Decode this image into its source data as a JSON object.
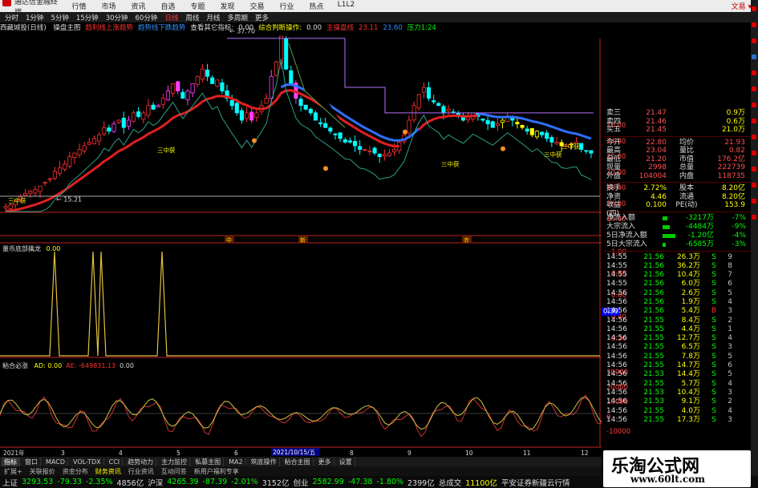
{
  "menubar": {
    "app_title": "通达信金融终端",
    "items": [
      "行情",
      "市场",
      "资讯",
      "自选",
      "专题",
      "发现",
      "交易",
      "行业",
      "热点",
      "L1L2"
    ],
    "right_text": "文易 ▾"
  },
  "periods": [
    "分时",
    "1分钟",
    "5分钟",
    "15分钟",
    "30分钟",
    "60分钟",
    "日线",
    "周线",
    "月线",
    "多周期",
    "更多"
  ],
  "period_active_index": 6,
  "chart_header": {
    "stock": "西藏城投(日线)",
    "items": [
      {
        "text": "操盘主图",
        "color": "#dddddd"
      },
      {
        "text": "趋利线上涨趋势",
        "color": "#ff3030"
      },
      {
        "text": "趋势线下跌趋势",
        "color": "#3090ff"
      },
      {
        "text": "查看其它指标:",
        "color": "#dddddd"
      },
      {
        "text": "0.00",
        "color": "#dddddd"
      },
      {
        "text": "综合判断操作:",
        "color": "#ffff00"
      },
      {
        "text": "0.00",
        "color": "#dddddd"
      },
      {
        "text": "主操盘线",
        "color": "#ff3030"
      },
      {
        "text": "23.11",
        "color": "#ff3030"
      },
      {
        "text": "23.60",
        "color": "#3090ff"
      },
      {
        "text": "压力1:24",
        "color": "#00ff00"
      }
    ]
  },
  "main_chart": {
    "high_label": "37.70",
    "low_label": "15.21",
    "signal_labels": [
      "三中获",
      "三中获",
      "三中获",
      "三中获",
      "三中获"
    ],
    "badges": [
      "中",
      "新",
      "赤"
    ],
    "price_axis": [
      "26.00",
      "24.00",
      "22.00",
      "20.00",
      "18.00",
      "16.00",
      "14.00"
    ]
  },
  "indicator1": {
    "label": "量币底部擒龙",
    "value": "0.00",
    "axis": [
      "1.00",
      "0.80",
      "0.60",
      "0.40",
      "0.20"
    ],
    "current": "0.39"
  },
  "indicator2": {
    "label": "粘合必涨",
    "items": [
      {
        "text": "AD: 0.00",
        "color": "#ffff00"
      },
      {
        "text": "AE: -649831.13",
        "color": "#ff3030"
      },
      {
        "text": "0.00",
        "color": "#dddddd"
      }
    ],
    "axis": [
      "30000",
      "20000",
      "10000",
      "0",
      "-10000"
    ]
  },
  "date_axis": {
    "labels": [
      "2021年",
      "3",
      "4",
      "5",
      "6",
      "7",
      "8",
      "9",
      "10",
      "11",
      "12"
    ],
    "highlight": "2021/10/15/五"
  },
  "quote": {
    "asks": [
      {
        "label": "卖三",
        "price": "21.47",
        "vol": "0.9万",
        "color": "#ff5050"
      },
      {
        "label": "卖四",
        "price": "21.46",
        "vol": "0.6万",
        "color": "#ff5050"
      },
      {
        "label": "买五",
        "price": "21.45",
        "vol": "21.0万",
        "color": "#ff5050"
      }
    ],
    "stats": [
      {
        "l1": "今开",
        "v1": "22.80",
        "l2": "均价",
        "v2": "21.93"
      },
      {
        "l1": "最高",
        "v1": "23.04",
        "l2": "量比",
        "v2": "0.82"
      },
      {
        "l1": "最低",
        "v1": "21.20",
        "l2": "市值",
        "v2": "176.2亿"
      },
      {
        "l1": "现量",
        "v1": "2998",
        "l2": "总量",
        "v2": "222739"
      },
      {
        "l1": "外盘",
        "v1": "104004",
        "l2": "内盘",
        "v2": "118735"
      }
    ],
    "fund": [
      {
        "l1": "换手",
        "v1": "2.72%",
        "l2": "股本",
        "v2": "8.20亿"
      },
      {
        "l1": "净资",
        "v1": "4.46",
        "l2": "流通",
        "v2": "8.20亿"
      },
      {
        "l1": "收益(四)",
        "v1": "0.100",
        "l2": "PE(动)",
        "v2": "153.9"
      }
    ],
    "flows": [
      {
        "name": "净流入额",
        "val": "-3217万",
        "pct": "-7%",
        "w": 6
      },
      {
        "name": "大宗流入",
        "val": "-4484万",
        "pct": "-9%",
        "w": 9
      },
      {
        "name": "5日净流入额",
        "val": "-1.20亿",
        "pct": "-4%",
        "w": 16
      },
      {
        "name": "5日大宗流入",
        "val": "-6585万",
        "pct": "-3%",
        "w": 4
      }
    ],
    "trades": [
      {
        "t": "14:55",
        "p": "21.56",
        "v": "26.3万",
        "s": "S",
        "n": "9"
      },
      {
        "t": "14:55",
        "p": "21.56",
        "v": "36.2万",
        "s": "S",
        "n": "8"
      },
      {
        "t": "14:55",
        "p": "21.56",
        "v": "10.4万",
        "s": "S",
        "n": "7"
      },
      {
        "t": "14:55",
        "p": "21.56",
        "v": "6.0万",
        "s": "S",
        "n": "6"
      },
      {
        "t": "14:56",
        "p": "21.56",
        "v": "2.6万",
        "s": "S",
        "n": "5"
      },
      {
        "t": "14:56",
        "p": "21.56",
        "v": "1.9万",
        "s": "S",
        "n": "4"
      },
      {
        "t": "14:56",
        "p": "21.56",
        "v": "5.4万",
        "s": "B",
        "n": "3"
      },
      {
        "t": "14:56",
        "p": "21.55",
        "v": "8.4万",
        "s": "S",
        "n": "2"
      },
      {
        "t": "14:56",
        "p": "21.55",
        "v": "4.4万",
        "s": "S",
        "n": "1"
      },
      {
        "t": "14:56",
        "p": "21.55",
        "v": "12.7万",
        "s": "S",
        "n": "4"
      },
      {
        "t": "14:56",
        "p": "21.55",
        "v": "6.5万",
        "s": "S",
        "n": "3"
      },
      {
        "t": "14:56",
        "p": "21.55",
        "v": "7.8万",
        "s": "S",
        "n": "5"
      },
      {
        "t": "14:56",
        "p": "21.55",
        "v": "14.7万",
        "s": "S",
        "n": "6"
      },
      {
        "t": "14:56",
        "p": "21.53",
        "v": "14.4万",
        "s": "S",
        "n": "5"
      },
      {
        "t": "14:56",
        "p": "21.55",
        "v": "5.7万",
        "s": "S",
        "n": "4"
      },
      {
        "t": "14:56",
        "p": "21.53",
        "v": "10.4万",
        "s": "S",
        "n": "3"
      },
      {
        "t": "14:56",
        "p": "21.53",
        "v": "9.1万",
        "s": "S",
        "n": "2"
      },
      {
        "t": "14:56",
        "p": "21.55",
        "v": "4.0万",
        "s": "S",
        "n": "4"
      },
      {
        "t": "14:56",
        "p": "21.55",
        "v": "17.3万",
        "s": "S",
        "n": "3"
      }
    ]
  },
  "tabs": [
    "指标",
    "窗口",
    "MACD",
    "VOL-TDX",
    "CCI",
    "趋势动力",
    "主力监控",
    "私募主图",
    "MA2",
    "筑底操作",
    "粘合主图",
    "更多",
    "设置"
  ],
  "tabs2": [
    "扩展+",
    "关联报价",
    "资金分布",
    "财务资讯",
    "行业资讯",
    "互动问答",
    "新用户福利专享"
  ],
  "tabs2_active": [
    3
  ],
  "status": [
    {
      "text": "上证",
      "color": "#dddddd"
    },
    {
      "text": "3293.53",
      "color": "#00ff00"
    },
    {
      "text": "-79.33",
      "color": "#00ff00"
    },
    {
      "text": "-2.35%",
      "color": "#00ff00"
    },
    {
      "text": "4856亿",
      "color": "#dddddd"
    },
    {
      "text": "沪深",
      "color": "#dddddd"
    },
    {
      "text": "4265.39",
      "color": "#00ff00"
    },
    {
      "text": "-87.39",
      "color": "#00ff00"
    },
    {
      "text": "-2.01%",
      "color": "#00ff00"
    },
    {
      "text": "3152亿",
      "color": "#dddddd"
    },
    {
      "text": "创业",
      "color": "#dddddd"
    },
    {
      "text": "2582.99",
      "color": "#00ff00"
    },
    {
      "text": "-47.38",
      "color": "#00ff00"
    },
    {
      "text": "-1.80%",
      "color": "#00ff00"
    },
    {
      "text": "2399亿",
      "color": "#dddddd"
    },
    {
      "text": "总成交",
      "color": "#dddddd"
    },
    {
      "text": "11100亿",
      "color": "#ffff00"
    },
    {
      "text": "平安证券新疆云行情",
      "color": "#dddddd"
    }
  ],
  "watermark": {
    "title": "乐淘公式网",
    "url": "www.60lt.com"
  }
}
